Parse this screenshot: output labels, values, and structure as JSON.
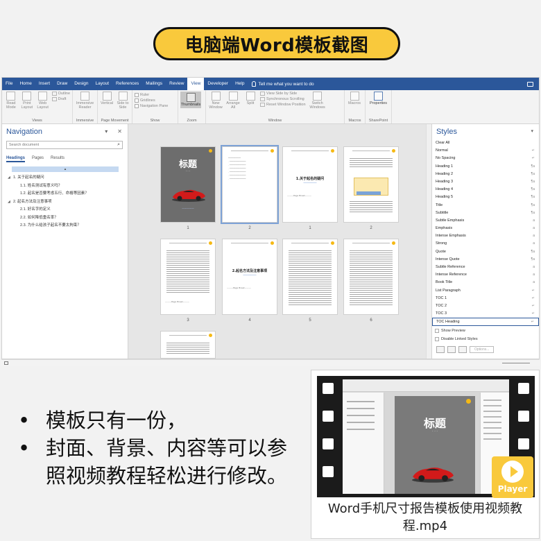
{
  "title": "电脑端Word模板截图",
  "word": {
    "menu": [
      "File",
      "Home",
      "Insert",
      "Draw",
      "Design",
      "Layout",
      "References",
      "Mailings",
      "Review",
      "View",
      "Developer",
      "Help"
    ],
    "active_menu": "View",
    "tell_me": "Tell me what you want to do",
    "ribbon": {
      "views": {
        "read_mode": "Read Mode",
        "print_layout": "Print Layout",
        "web_layout": "Web Layout",
        "outline": "Outline",
        "draft": "Draft",
        "group": "Views"
      },
      "immersive": {
        "reader": "Immersive Reader",
        "group": "Immersive"
      },
      "page_movement": {
        "vertical": "Vertical",
        "side_to_side": "Side to Side",
        "group": "Page Movement"
      },
      "show": {
        "ruler": "Ruler",
        "gridlines": "Gridlines",
        "navigation_pane": "Navigation Pane",
        "group": "Show"
      },
      "zoom": {
        "thumbnails": "Thumbnails",
        "group": "Zoom"
      },
      "window": {
        "new_window": "New Window",
        "arrange_all": "Arrange All",
        "split": "Split",
        "view_side_by_side": "View Side by Side",
        "sync_scrolling": "Synchronous Scrolling",
        "reset_window": "Reset Window Position",
        "switch_windows": "Switch Windows",
        "group": "Window"
      },
      "macros": {
        "label": "Macros",
        "group": "Macros"
      },
      "sharepoint": {
        "properties": "Properties",
        "group": "SharePoint"
      }
    },
    "navigation": {
      "title": "Navigation",
      "search_placeholder": "Search document",
      "tabs": [
        "Headings",
        "Pages",
        "Results"
      ],
      "items": [
        {
          "level": 1,
          "text": "1. 关于起名的疑问"
        },
        {
          "level": 2,
          "text": "1.1. 姓名测试有意义吗？"
        },
        {
          "level": 2,
          "text": "1.2. 起名是否要考虑五行、命格等因素？"
        },
        {
          "level": 1,
          "text": "2. 起名方法及注意事项"
        },
        {
          "level": 2,
          "text": "2.1. 好名字的定义"
        },
        {
          "level": 2,
          "text": "2.2. 如何降低重名率？"
        },
        {
          "level": 2,
          "text": "2.3. 为什么给孩子起名不要太拘束？"
        }
      ]
    },
    "thumbnails": {
      "cover_title": "标题",
      "page_labels": [
        "1",
        "2",
        "1",
        "2",
        "3",
        "4",
        "5",
        "6"
      ],
      "section1_heading": "1.关于起名的疑问",
      "section2_heading": "2.起名方法及注意事项",
      "page_break": "Page Break"
    },
    "styles": {
      "title": "Styles",
      "items": [
        "Clear All",
        "Normal",
        "No Spacing",
        "Heading 1",
        "Heading 2",
        "Heading 3",
        "Heading 4",
        "Heading 5",
        "Title",
        "Subtitle",
        "Subtle Emphasis",
        "Emphasis",
        "Intense Emphasis",
        "Strong",
        "Quote",
        "Intense Quote",
        "Subtle Reference",
        "Intense Reference",
        "Book Title",
        "List Paragraph",
        "TOC 1",
        "TOC 2",
        "TOC 3",
        "TOC Heading"
      ],
      "selected": "TOC Heading",
      "show_preview": "Show Preview",
      "disable_linked": "Disable Linked Styles",
      "options": "Options..."
    }
  },
  "bullets": [
    "模板只有一份，",
    "封面、背景、内容等可以参照视频教程轻松进行修改。"
  ],
  "video": {
    "caption": "Word手机尺寸报告模板使用视频教程.mp4",
    "player_label": "Player",
    "frame_title": "标题"
  }
}
